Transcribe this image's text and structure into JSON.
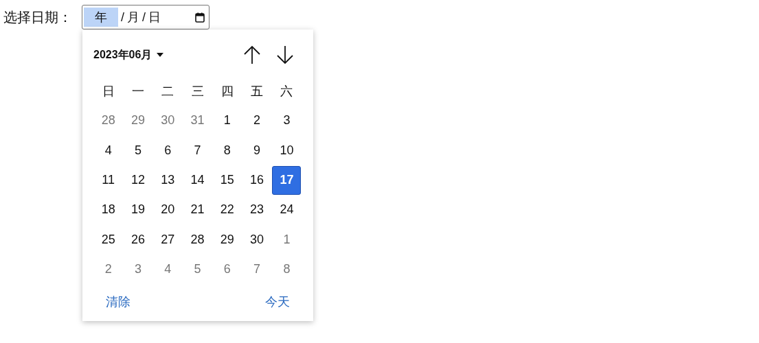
{
  "label": "选择日期：",
  "date_field": {
    "segments": [
      {
        "text": "年",
        "selected": true
      },
      {
        "text": "月",
        "selected": false
      },
      {
        "text": "日",
        "selected": false
      }
    ],
    "separator": "/"
  },
  "picker": {
    "month_label": "2023年06月",
    "weekdays": [
      "日",
      "一",
      "二",
      "三",
      "四",
      "五",
      "六"
    ],
    "days": [
      {
        "text": "28",
        "other_month": true,
        "selected": false
      },
      {
        "text": "29",
        "other_month": true,
        "selected": false
      },
      {
        "text": "30",
        "other_month": true,
        "selected": false
      },
      {
        "text": "31",
        "other_month": true,
        "selected": false
      },
      {
        "text": "1",
        "other_month": false,
        "selected": false
      },
      {
        "text": "2",
        "other_month": false,
        "selected": false
      },
      {
        "text": "3",
        "other_month": false,
        "selected": false
      },
      {
        "text": "4",
        "other_month": false,
        "selected": false
      },
      {
        "text": "5",
        "other_month": false,
        "selected": false
      },
      {
        "text": "6",
        "other_month": false,
        "selected": false
      },
      {
        "text": "7",
        "other_month": false,
        "selected": false
      },
      {
        "text": "8",
        "other_month": false,
        "selected": false
      },
      {
        "text": "9",
        "other_month": false,
        "selected": false
      },
      {
        "text": "10",
        "other_month": false,
        "selected": false
      },
      {
        "text": "11",
        "other_month": false,
        "selected": false
      },
      {
        "text": "12",
        "other_month": false,
        "selected": false
      },
      {
        "text": "13",
        "other_month": false,
        "selected": false
      },
      {
        "text": "14",
        "other_month": false,
        "selected": false
      },
      {
        "text": "15",
        "other_month": false,
        "selected": false
      },
      {
        "text": "16",
        "other_month": false,
        "selected": false
      },
      {
        "text": "17",
        "other_month": false,
        "selected": true
      },
      {
        "text": "18",
        "other_month": false,
        "selected": false
      },
      {
        "text": "19",
        "other_month": false,
        "selected": false
      },
      {
        "text": "20",
        "other_month": false,
        "selected": false
      },
      {
        "text": "21",
        "other_month": false,
        "selected": false
      },
      {
        "text": "22",
        "other_month": false,
        "selected": false
      },
      {
        "text": "23",
        "other_month": false,
        "selected": false
      },
      {
        "text": "24",
        "other_month": false,
        "selected": false
      },
      {
        "text": "25",
        "other_month": false,
        "selected": false
      },
      {
        "text": "26",
        "other_month": false,
        "selected": false
      },
      {
        "text": "27",
        "other_month": false,
        "selected": false
      },
      {
        "text": "28",
        "other_month": false,
        "selected": false
      },
      {
        "text": "29",
        "other_month": false,
        "selected": false
      },
      {
        "text": "30",
        "other_month": false,
        "selected": false
      },
      {
        "text": "1",
        "other_month": true,
        "selected": false
      },
      {
        "text": "2",
        "other_month": true,
        "selected": false
      },
      {
        "text": "3",
        "other_month": true,
        "selected": false
      },
      {
        "text": "4",
        "other_month": true,
        "selected": false
      },
      {
        "text": "5",
        "other_month": true,
        "selected": false
      },
      {
        "text": "6",
        "other_month": true,
        "selected": false
      },
      {
        "text": "7",
        "other_month": true,
        "selected": false
      },
      {
        "text": "8",
        "other_month": true,
        "selected": false
      }
    ],
    "clear_button": "清除",
    "today_button": "今天"
  }
}
